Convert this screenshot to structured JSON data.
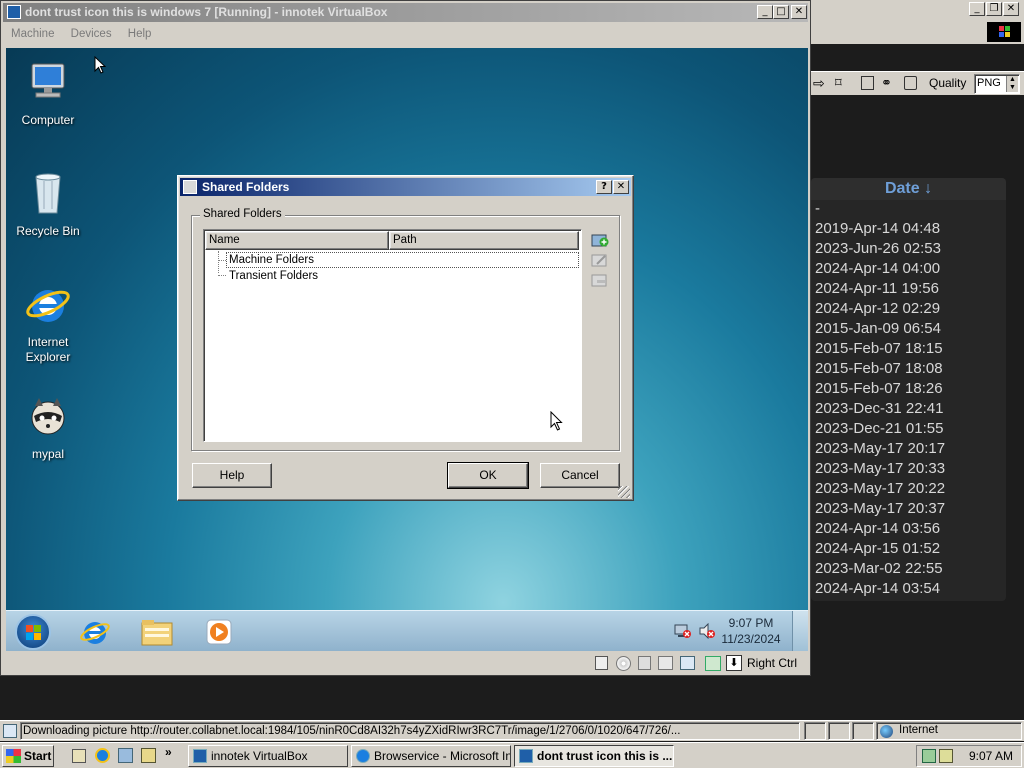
{
  "vbox": {
    "title": "dont trust icon this is windows 7 [Running] - innotek VirtualBox",
    "menu": [
      "Machine",
      "Devices",
      "Help"
    ],
    "status_host_key": "Right Ctrl"
  },
  "guest": {
    "desktop_icons": [
      {
        "label": "Computer"
      },
      {
        "label": "Recycle Bin"
      },
      {
        "label": "Internet Explorer"
      },
      {
        "label": "mypal"
      }
    ],
    "clock_time": "9:07 PM",
    "clock_date": "11/23/2024"
  },
  "dialog": {
    "title": "Shared Folders",
    "help_glyph": "?",
    "group_label": "Shared Folders",
    "columns": [
      "Name",
      "Path"
    ],
    "tree_items": [
      "Machine Folders",
      "Transient Folders"
    ],
    "help_button": "Help",
    "ok_button": "OK",
    "cancel_button": "Cancel"
  },
  "right_app": {
    "quality_label": "Quality",
    "quality_value": "PNG",
    "date_header": "Date ↓",
    "dates": [
      "-",
      "2019-Apr-14 04:48",
      "2023-Jun-26 02:53",
      "2024-Apr-14 04:00",
      "2024-Apr-11 19:56",
      "2024-Apr-12 02:29",
      "2015-Jan-09 06:54",
      "2015-Feb-07 18:15",
      "2015-Feb-07 18:08",
      "2015-Feb-07 18:26",
      "2023-Dec-31 22:41",
      "2023-Dec-21 01:55",
      "2023-May-17 20:17",
      "2023-May-17 20:33",
      "2023-May-17 20:22",
      "2023-May-17 20:37",
      "2024-Apr-14 03:56",
      "2024-Apr-15 01:52",
      "2023-Mar-02 22:55",
      "2024-Apr-14 03:54"
    ]
  },
  "ie_status": {
    "text": "Downloading picture http://router.collabnet.local:1984/105/ninR0Cd8AI32h7s4yZXidRIwr3RC7Tr/image/1/2706/0/1020/647/726/...",
    "zone": "Internet"
  },
  "host_taskbar": {
    "start": "Start",
    "buttons": [
      {
        "label": "innotek VirtualBox"
      },
      {
        "label": "Browservice - Microsoft Int..."
      },
      {
        "label": "dont trust icon this is ..."
      }
    ],
    "clock": "9:07 AM"
  },
  "colors": {
    "title_active": "#0a246a",
    "title_inactive": "#808080",
    "face": "#d4d0c8",
    "right_bg": "#1c1c1c",
    "date_header": "#6f9fd8"
  }
}
